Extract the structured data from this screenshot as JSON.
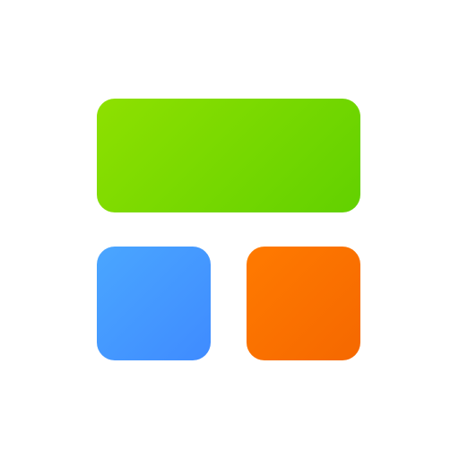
{
  "icon": {
    "name": "widget-grid-icon",
    "background": "#ffffff",
    "tiles": [
      {
        "name": "wide-tile",
        "color_start": "#8ee000",
        "color_end": "#62d100"
      },
      {
        "name": "left-tile",
        "color_start": "#4aa6ff",
        "color_end": "#3f8bff"
      },
      {
        "name": "right-tile",
        "color_start": "#ff7a00",
        "color_end": "#f56800"
      }
    ]
  }
}
